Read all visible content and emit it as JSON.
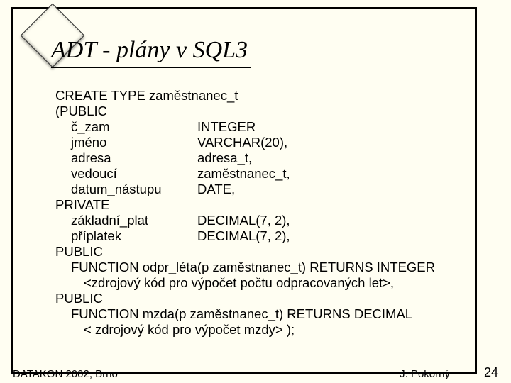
{
  "title": "ADT - plány v SQL3",
  "code": {
    "lines": [
      {
        "level": 0,
        "text": "CREATE TYPE zaměstnanec_t"
      },
      {
        "level": 0,
        "text": "(PUBLIC"
      },
      {
        "level": 1,
        "name": "č_zam",
        "type": "INTEGER"
      },
      {
        "level": 1,
        "name": "jméno",
        "type": "VARCHAR(20),"
      },
      {
        "level": 1,
        "name": "adresa",
        "type": "adresa_t,"
      },
      {
        "level": 1,
        "name": "vedoucí",
        "type": "zaměstnanec_t,"
      },
      {
        "level": 1,
        "name": "datum_nástupu",
        "type": "DATE,"
      },
      {
        "level": 0,
        "text": "PRIVATE"
      },
      {
        "level": 1,
        "name": "základní_plat",
        "type": "DECIMAL(7, 2),"
      },
      {
        "level": 1,
        "name": "příplatek",
        "type": "DECIMAL(7, 2),"
      },
      {
        "level": 0,
        "text": "PUBLIC"
      },
      {
        "level": 1,
        "text": "FUNCTION odpr_léta(p zaměstnanec_t) RETURNS INTEGER"
      },
      {
        "level": 2,
        "text": "<zdrojový kód pro výpočet počtu odpracovaných let>,"
      },
      {
        "level": 0,
        "text": "PUBLIC"
      },
      {
        "level": 1,
        "text": "FUNCTION mzda(p zaměstnanec_t) RETURNS DECIMAL"
      },
      {
        "level": 2,
        "text": "< zdrojový kód pro výpočet  mzdy> );"
      }
    ]
  },
  "footer": {
    "left": "DATAKON 2002, Brno",
    "author": "J. Pokorný",
    "page": "24"
  }
}
